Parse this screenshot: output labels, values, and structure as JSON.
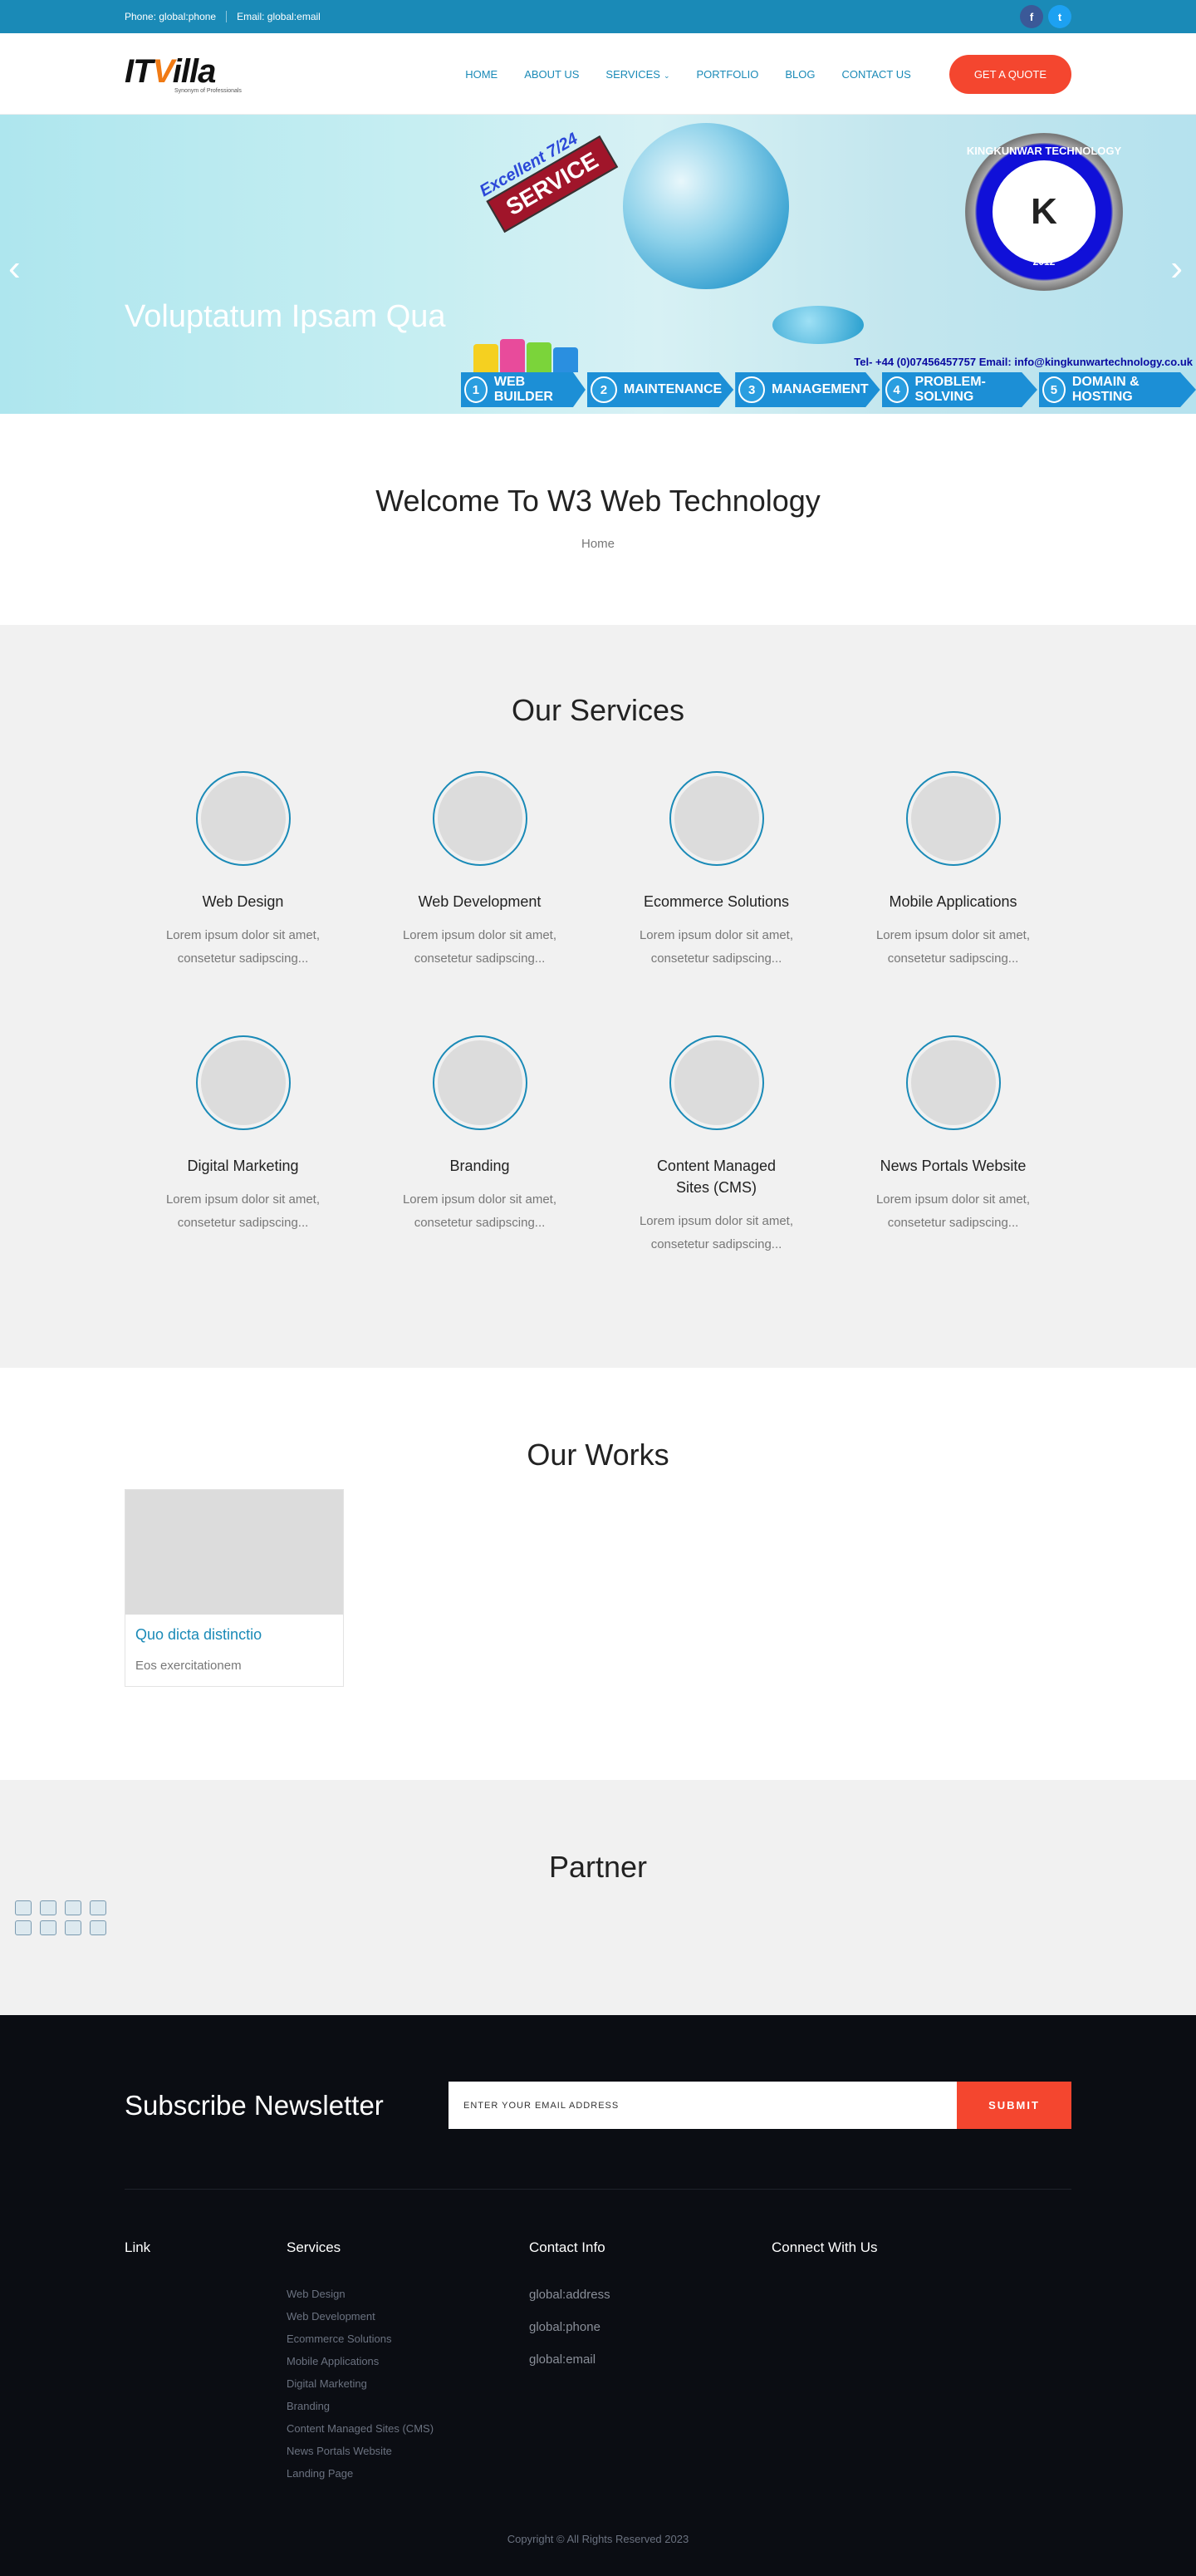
{
  "topbar": {
    "phone": "Phone: global:phone",
    "email": "Email: global:email",
    "social": [
      "f",
      "t"
    ]
  },
  "header": {
    "logo_it": "IT",
    "logo_v": "V",
    "logo_illa": "illa",
    "logo_tag": "Synonym of Professionals",
    "nav": [
      "HOME",
      "ABOUT US",
      "SERVICES",
      "PORTFOLIO",
      "BLOG",
      "CONTACT US"
    ],
    "services_caret": "⌄",
    "cta": "GET A QUOTE"
  },
  "hero": {
    "slide_title": "Voluptatum Ipsam Qua",
    "prev": "‹",
    "next": "›",
    "banner": {
      "excellent": "Excellent 7/24",
      "service": "SERVICE",
      "badge_top": "KINGKUNWAR TECHNOLOGY",
      "badge_mark": "K",
      "badge_year": "2012",
      "contact": "Tel- +44 (0)07456457757  Email: info@kingkunwartechnology.co.uk",
      "steps": [
        {
          "num": "1",
          "label": "WEB BUILDER"
        },
        {
          "num": "2",
          "label": "MAINTENANCE"
        },
        {
          "num": "3",
          "label": "MANAGEMENT"
        },
        {
          "num": "4",
          "label": "PROBLEM-SOLVING"
        },
        {
          "num": "5",
          "label": "DOMAIN & HOSTING"
        }
      ]
    }
  },
  "welcome": {
    "title": "Welcome To W3 Web Technology",
    "breadcrumb": "Home"
  },
  "services": {
    "title": "Our Services",
    "items": [
      {
        "title": "Web Design",
        "desc": "Lorem ipsum dolor sit amet, consetetur sadipscing..."
      },
      {
        "title": "Web Development",
        "desc": "Lorem ipsum dolor sit amet, consetetur sadipscing..."
      },
      {
        "title": "Ecommerce Solutions",
        "desc": "Lorem ipsum dolor sit amet, consetetur sadipscing..."
      },
      {
        "title": "Mobile Applications",
        "desc": "Lorem ipsum dolor sit amet, consetetur sadipscing..."
      },
      {
        "title": "Digital Marketing",
        "desc": "Lorem ipsum dolor sit amet, consetetur sadipscing..."
      },
      {
        "title": "Branding",
        "desc": "Lorem ipsum dolor sit amet, consetetur sadipscing..."
      },
      {
        "title": "Content Managed Sites (CMS)",
        "desc": "Lorem ipsum dolor sit amet, consetetur sadipscing..."
      },
      {
        "title": "News Portals Website",
        "desc": "Lorem ipsum dolor sit amet, consetetur sadipscing..."
      }
    ]
  },
  "works": {
    "title": "Our Works",
    "items": [
      {
        "title": "Quo dicta distinctio",
        "subtitle": "Eos exercitationem"
      }
    ]
  },
  "partner": {
    "title": "Partner"
  },
  "footer": {
    "subscribe_title": "Subscribe Newsletter",
    "email_placeholder": "ENTER YOUR EMAIL ADDRESS",
    "submit": "SUBMIT",
    "link_heading": "Link",
    "services_heading": "Services",
    "services_links": [
      "Web Design",
      "Web Development",
      "Ecommerce Solutions",
      "Mobile Applications",
      "Digital Marketing",
      "Branding",
      "Content Managed Sites (CMS)",
      "News Portals Website",
      "Landing Page"
    ],
    "contact_heading": "Contact Info",
    "contact": [
      "global:address",
      "global:phone",
      "global:email"
    ],
    "connect_heading": "Connect With Us",
    "copyright": "Copyright © All Rights Reserved 2023"
  },
  "colors": {
    "primary": "#1a8ab7",
    "accent": "#f4462f",
    "footer_bg": "#0b0d13",
    "section_bg": "#f1f1f1"
  }
}
